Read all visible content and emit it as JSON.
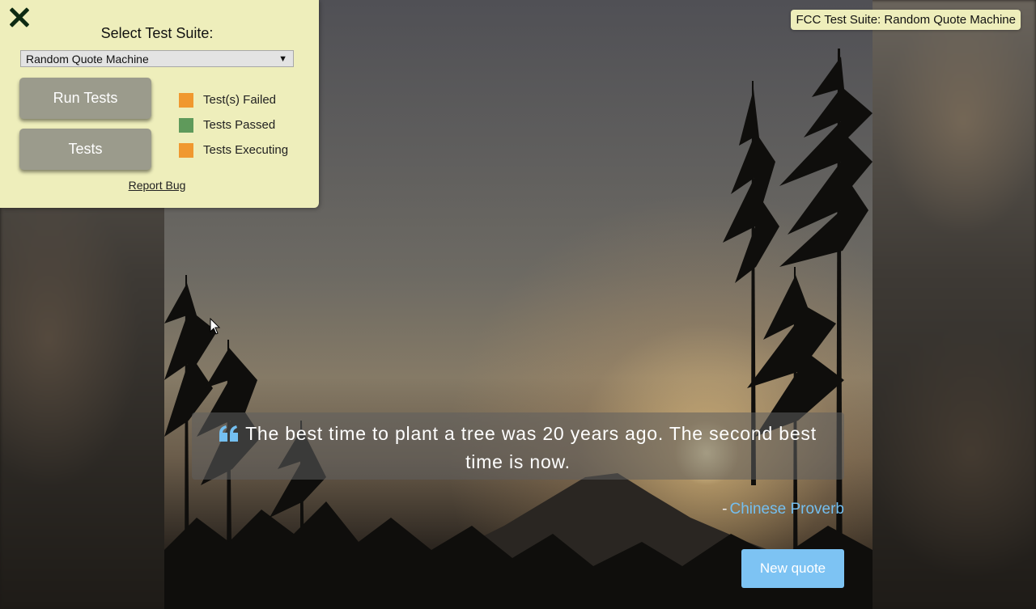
{
  "fcc_panel": {
    "suite_label": "Select Test Suite:",
    "selected_suite": "Random Quote Machine",
    "select_arrow": "▼",
    "run_tests_label": "Run Tests",
    "tests_label": "Tests",
    "legend": [
      {
        "label": "Test(s) Failed",
        "color": "#f0982f"
      },
      {
        "label": "Tests Passed",
        "color": "#5f9a5b"
      },
      {
        "label": "Tests Executing",
        "color": "#f0982f"
      }
    ],
    "report_bug_label": "Report Bug"
  },
  "fcc_badge": "FCC Test Suite: Random Quote Machine",
  "quote": {
    "text": "The best time to plant a tree was 20 years ago. The second best time is now.",
    "dash": "-",
    "author": "Chinese Proverb",
    "new_quote_label": "New quote",
    "accent_color": "#7dc3f3"
  }
}
